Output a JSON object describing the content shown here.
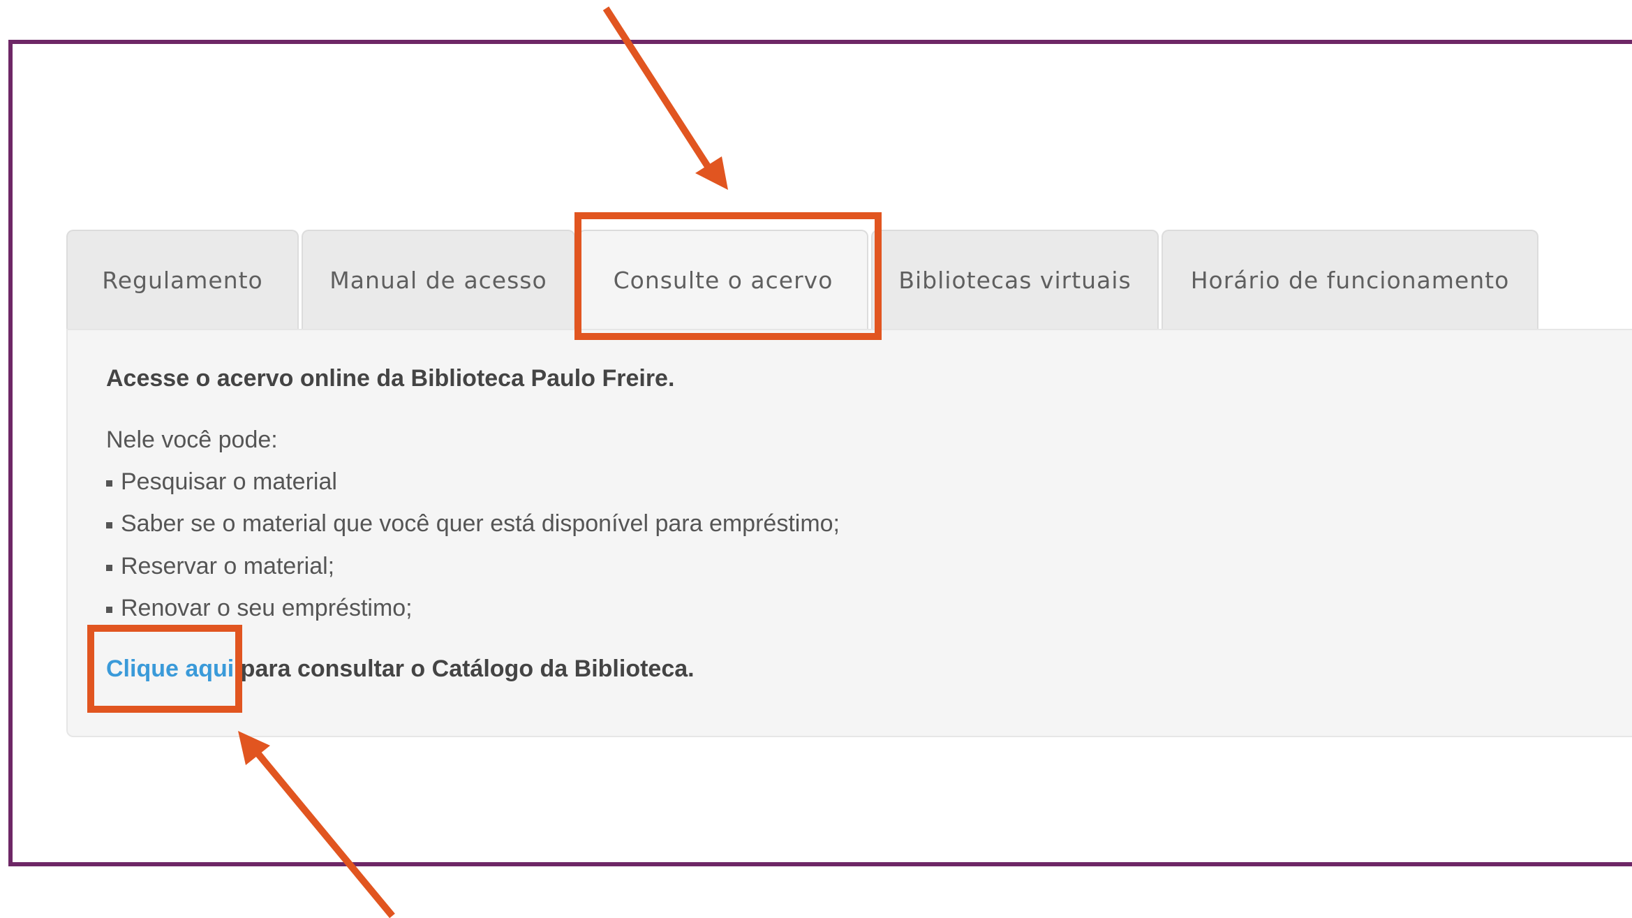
{
  "tabs": [
    {
      "label": "Regulamento"
    },
    {
      "label": "Manual de acesso"
    },
    {
      "label": "Consulte o acervo"
    },
    {
      "label": "Bibliotecas virtuais"
    },
    {
      "label": "Horário de funcionamento"
    }
  ],
  "active_tab": "Consulte o acervo",
  "panel": {
    "heading": "Acesse o acervo online da Biblioteca Paulo Freire.",
    "intro": "Nele você pode:",
    "items": [
      "Pesquisar o material",
      "Saber se o material que você quer está disponível para empréstimo;",
      "Reservar o material;",
      "Renovar o seu empréstimo;"
    ],
    "link_text": "Clique aqui",
    "link_suffix": " para consultar o Catálogo da Biblioteca."
  },
  "colors": {
    "frame": "#6e2766",
    "highlight": "#e15520",
    "link": "#3a9ad9",
    "tab_bg": "#eaeaea",
    "panel_bg": "#f5f5f5"
  }
}
